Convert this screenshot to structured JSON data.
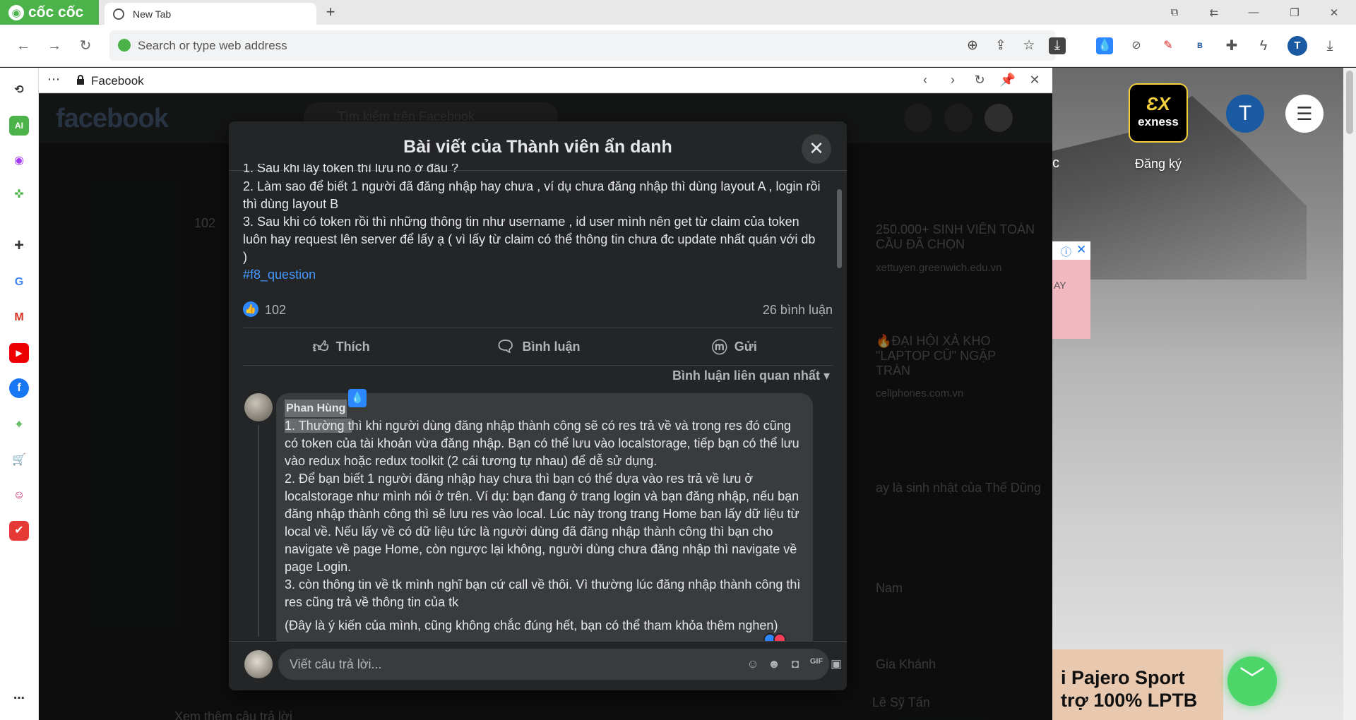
{
  "browser": {
    "brand": "cốc cốc",
    "tab_title": "New Tab",
    "omnibox_placeholder": "Search or type web address"
  },
  "panel": {
    "title": "Facebook"
  },
  "facebook": {
    "logo": "facebook",
    "search_placeholder": "Tìm kiếm trên Facebook",
    "background_snippets": [
      "250.000+ SINH VIÊN TOÀN CẦU ĐÃ CHỌN",
      "xettuyen.greenwich.edu.vn",
      "🔥ĐẠI HỘI XẢ KHO \"LAPTOP CŨ\" NGẬP TRÀN",
      "cellphones.com.vn",
      "ay là sinh nhật của Thế Dũng",
      "Nam",
      "Gia Khánh",
      "Lê Sỹ Tấn",
      "Xem thêm câu trả lời",
      "102"
    ]
  },
  "modal": {
    "title": "Bài viết của Thành viên ẩn danh",
    "post_clipped_line": "1. Sau khi lấy token thì lưu nó ở đâu ?",
    "post_lines": [
      "2. Làm sao để biết 1 người đã đăng nhập hay chưa , ví dụ chưa đăng nhập thì dùng layout A , login rồi thì dùng layout B",
      "3. Sau khi có token rồi thì những thông tin như username , id user mình nên get từ claim của token luôn hay request lên server để lấy ạ ( vì lấy từ claim có thể thông tin chưa đc update nhất quán với db )"
    ],
    "hashtag": "#f8_question",
    "like_count": "102",
    "comment_count": "26 bình luận",
    "actions": {
      "like": "Thích",
      "comment": "Bình luận",
      "send": "Gửi"
    },
    "sort_label": "Bình luận liên quan nhất",
    "comment": {
      "author": "Phan Hùng",
      "first_highlight": "1. Thường t",
      "body": "hì khi người dùng đăng nhập thành công sẽ có res trả về và trong res đó cũng có token của tài khoản vừa đăng nhập. Bạn có thể lưu vào localstorage, tiếp bạn có thể lưu vào redux hoặc redux toolkit (2 cái tương tự nhau) để dễ sử dụng.\n2. Để bạn biết 1 người đăng nhập hay chưa thì bạn có thể dựa vào res trả về lưu ở localstorage như mình nói ở trên. Ví dụ: bạn đang ở trang login và bạn đăng nhập, nếu bạn đăng nhập thành công thì sẽ lưu res vào local. Lúc này trong trang Home bạn lấy dữ liệu từ local về. Nếu lấy về có dữ liệu tức là người dùng đã đăng nhập thành công thì bạn cho navigate về page Home, còn ngược lại không, người dùng chưa đăng nhập thì navigate về page Login.\n3. còn thông tin về tk mình nghĩ bạn cứ call về thôi. Vì thường lúc đăng nhập thành công thì res cũng trả về thông tin của tk",
      "note": "(Đây là ý kiến của mình, cũng không chắc đúng hết, bạn có thể tham khỏa thêm nghen)"
    },
    "reply_placeholder": "Viết câu trả lời..."
  },
  "newtab": {
    "exness_top": "ƐX",
    "exness_name": "exness",
    "register_label": "Đăng ký",
    "avatar_letter": "T",
    "partial_char": "c",
    "ad_partial": "AY",
    "bottom_ad_line1": "i Pajero Sport",
    "bottom_ad_line2": "trợ 100% LPTB"
  },
  "profile_letter": "T"
}
